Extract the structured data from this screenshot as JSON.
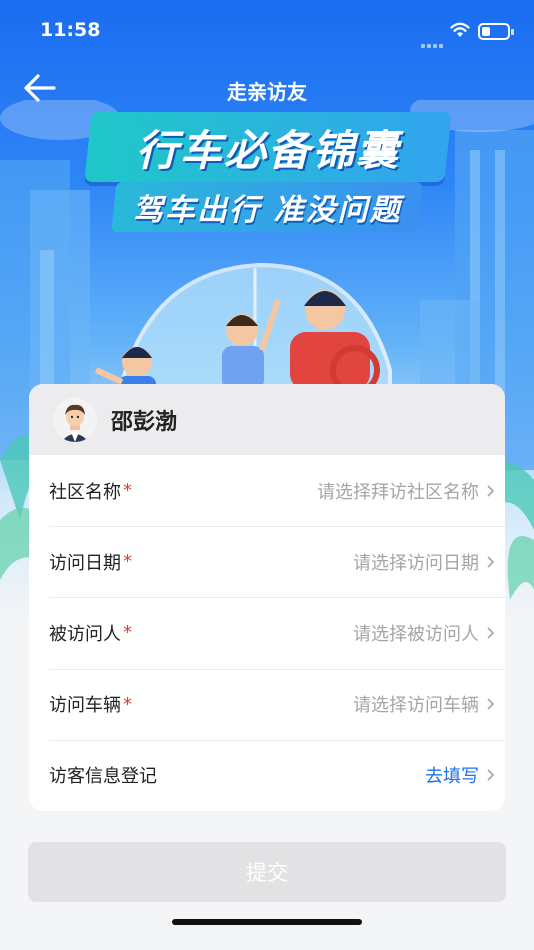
{
  "status_bar": {
    "time": "11:58"
  },
  "nav": {
    "title": "走亲访友"
  },
  "banner": {
    "main_text": "行车必备锦囊",
    "sub_text": "驾车出行  准没问题"
  },
  "user": {
    "name": "邵彭渤"
  },
  "form": {
    "rows": [
      {
        "label": "社区名称",
        "required": "*",
        "placeholder": "请选择拜访社区名称"
      },
      {
        "label": "访问日期",
        "required": "*",
        "placeholder": "请选择访问日期"
      },
      {
        "label": "被访问人",
        "required": "*",
        "placeholder": "请选择被访问人"
      },
      {
        "label": "访问车辆",
        "required": "*",
        "placeholder": "请选择访问车辆"
      },
      {
        "label": "访客信息登记",
        "required": "",
        "placeholder": "去填写"
      }
    ]
  },
  "submit": {
    "label": "提交"
  },
  "colors": {
    "primary": "#1d74e7",
    "required": "#e53935",
    "placeholder": "#a5a5a5"
  }
}
